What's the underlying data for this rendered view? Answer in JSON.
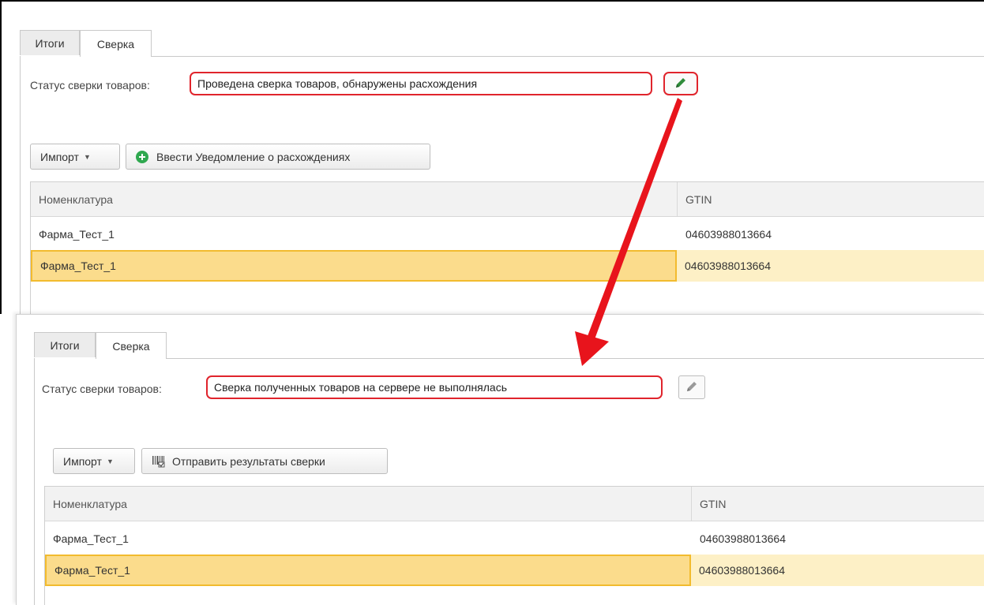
{
  "panels": [
    {
      "tabs": {
        "totals": "Итоги",
        "reconciliation": "Сверка"
      },
      "status_label": "Статус сверки товаров:",
      "status_value": "Проведена сверка товаров, обнаружены расхождения",
      "edit_icon": "pencil-icon",
      "edit_icon_color": "#2e8b3a",
      "import_label": "Импорт",
      "action_button": {
        "label": "Ввести Уведомление о расхождениях",
        "icon": "plus-circle-icon",
        "icon_color": "#2fa84f"
      },
      "columns": [
        "Номенклатура",
        "GTIN"
      ],
      "rows": [
        {
          "name": "Фарма_Тест_1",
          "gtin": "04603988013664",
          "selected": false
        },
        {
          "name": "Фарма_Тест_1",
          "gtin": "04603988013664",
          "selected": true
        }
      ]
    },
    {
      "tabs": {
        "totals": "Итоги",
        "reconciliation": "Сверка"
      },
      "status_label": "Статус сверки товаров:",
      "status_value": "Сверка полученных товаров на сервере не выполнялась",
      "edit_icon": "pencil-icon",
      "edit_icon_color": "#9a9a9a",
      "import_label": "Импорт",
      "action_button": {
        "label": "Отправить результаты сверки",
        "icon": "barcode-icon",
        "icon_color": "#555555"
      },
      "columns": [
        "Номенклатура",
        "GTIN"
      ],
      "rows": [
        {
          "name": "Фарма_Тест_1",
          "gtin": "04603988013664",
          "selected": false
        },
        {
          "name": "Фарма_Тест_1",
          "gtin": "04603988013664",
          "selected": true
        }
      ]
    }
  ],
  "colors": {
    "highlight": "#e0242c",
    "selected_row": "#fbdc8c",
    "selected_row_light": "#fdf0c6",
    "arrow": "#e8141c"
  }
}
